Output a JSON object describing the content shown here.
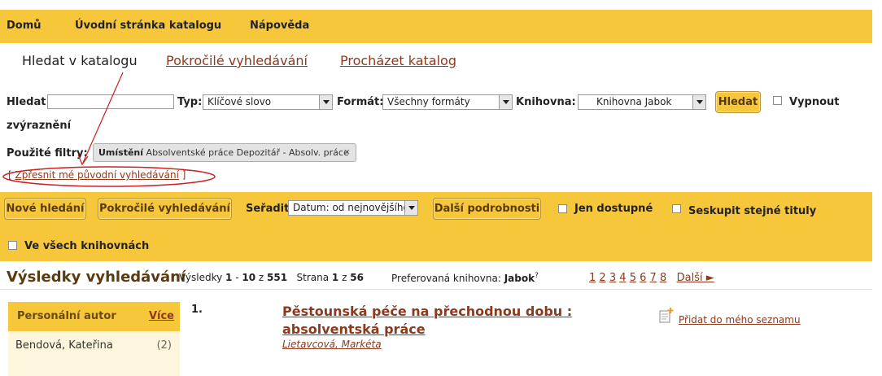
{
  "topnav": {
    "home": "Domů",
    "catalog_home": "Úvodní stránka katalogu",
    "help": "Nápověda"
  },
  "tabs": {
    "search": "Hledat v katalogu",
    "advanced": "Pokročilé vyhledávání",
    "browse": "Procházet katalog"
  },
  "search": {
    "label": "Hledat",
    "value": "",
    "type_label": "Typ:",
    "type_value": "Klíčové slovo",
    "format_label": "Formát:",
    "format_value": "Všechny formáty",
    "library_label": "Knihovna:",
    "library_value": "Knihovna Jabok",
    "submit": "Hledat",
    "highlight_off_1": "Vypnout",
    "highlight_off_2": "zvýraznění"
  },
  "filters": {
    "label": "Použité filtry:",
    "chip_key": "Umístění",
    "chip_value": "Absolventské práce Depozitář - Absolv. práce",
    "remove": "×",
    "refine_open": "[",
    "refine_link": "Zpřesnit mé původní vyhledávání",
    "refine_close": "]"
  },
  "toolbar": {
    "new_search": "Nové hledání",
    "advanced": "Pokročilé vyhledávání",
    "sort_label": "Seřadit",
    "sort_value": "Datum: od nejnovějšího",
    "details": "Další podrobnosti",
    "only_available": "Jen dostupné",
    "group_titles": "Seskupit stejné tituly",
    "all_libraries": "Ve všech knihovnách"
  },
  "results": {
    "heading": "Výsledky vyhledávání",
    "results_label": "Výsledky",
    "from": "1",
    "dash": " - ",
    "to": "10",
    "of": " z ",
    "total": "551",
    "page_label": "Strana",
    "page": "1",
    "page_of": " z ",
    "pages_total": "56",
    "pref_label": "Preferovaná knihovna:",
    "pref_value": "Jabok",
    "pref_help": "?",
    "page_links": [
      "1",
      "2",
      "3",
      "4",
      "5",
      "6",
      "7",
      "8"
    ],
    "next": "Další ►"
  },
  "facet": {
    "title": "Personální autor",
    "more": "Více",
    "item_name": "Bendová, Kateřina",
    "item_count": "(2)"
  },
  "record": {
    "number": "1.",
    "title_line1": "Pěstounská péče na přechodnou dobu :",
    "title_line2": "absolventská práce",
    "author": "Lietavcová, Markéta",
    "add_to_list": "Přidat do mého seznamu"
  },
  "colors": {
    "accent_yellow": "#f6c63b",
    "link_brown": "#8b3a1e",
    "annotation_red": "#cc1f1f"
  },
  "icons": {
    "add_list": "add-to-list-icon",
    "remove_filter": "close-icon",
    "dropdown": "chevron-down-icon"
  }
}
